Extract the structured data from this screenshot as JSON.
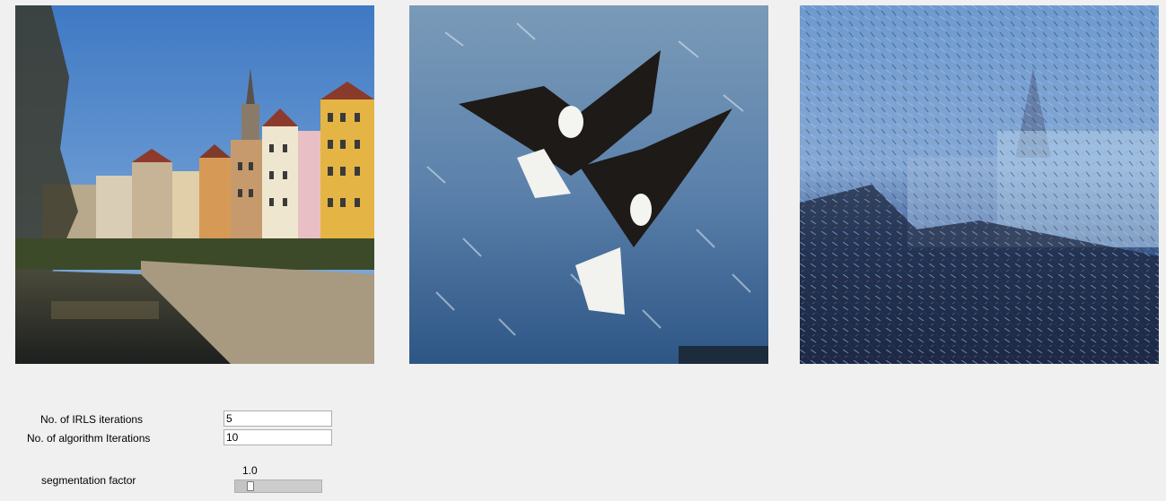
{
  "images": {
    "content": "content-image",
    "style": "style-image",
    "result": "result-image"
  },
  "params": {
    "irls_label": "No. of IRLS iterations",
    "irls_value": "5",
    "algo_label": "No. of algorithm Iterations",
    "algo_value": "10",
    "seg_label": "segmentation factor",
    "seg_value": "1.0",
    "seg_level": 0.15
  },
  "colors": {
    "window_bg": "#f0f0f0",
    "input_border": "#abadb3"
  }
}
